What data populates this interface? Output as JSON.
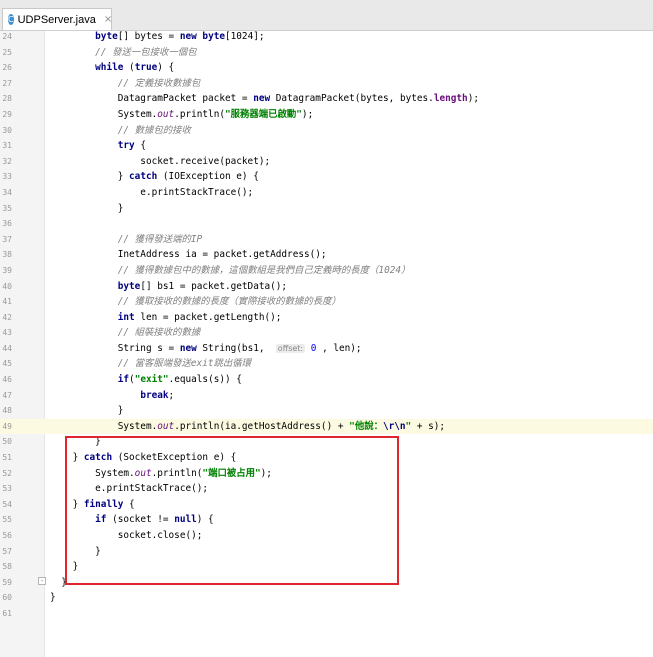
{
  "tab": {
    "icon": "C",
    "label": "UDPServer.java",
    "close": "×"
  },
  "lines": [
    {
      "n": "24",
      "segs": [
        [
          "p",
          "        "
        ],
        [
          "kw",
          "byte"
        ],
        [
          "p",
          "[] bytes = "
        ],
        [
          "kw",
          "new"
        ],
        [
          "p",
          " "
        ],
        [
          "kw",
          "byte"
        ],
        [
          "p",
          "[1024];"
        ]
      ]
    },
    {
      "n": "25",
      "segs": [
        [
          "p",
          "        "
        ],
        [
          "cm",
          "// 發送一包接收一個包"
        ]
      ]
    },
    {
      "n": "26",
      "segs": [
        [
          "p",
          "        "
        ],
        [
          "kw",
          "while"
        ],
        [
          "p",
          " ("
        ],
        [
          "kw",
          "true"
        ],
        [
          "p",
          ") {"
        ]
      ]
    },
    {
      "n": "27",
      "segs": [
        [
          "p",
          "            "
        ],
        [
          "cm",
          "// 定義接收數據包"
        ]
      ]
    },
    {
      "n": "28",
      "segs": [
        [
          "p",
          "            DatagramPacket packet = "
        ],
        [
          "kw",
          "new"
        ],
        [
          "p",
          " DatagramPacket(bytes, bytes."
        ],
        [
          "fld",
          "length"
        ],
        [
          "p",
          ");"
        ]
      ]
    },
    {
      "n": "29",
      "segs": [
        [
          "p",
          "            System."
        ],
        [
          "st",
          "out"
        ],
        [
          "p",
          ".println("
        ],
        [
          "str",
          "\"服務器端已啟動\""
        ],
        [
          "p",
          ");"
        ]
      ]
    },
    {
      "n": "30",
      "segs": [
        [
          "p",
          "            "
        ],
        [
          "cm",
          "// 數據包的接收"
        ]
      ]
    },
    {
      "n": "31",
      "segs": [
        [
          "p",
          "            "
        ],
        [
          "kw",
          "try"
        ],
        [
          "p",
          " {"
        ]
      ]
    },
    {
      "n": "32",
      "segs": [
        [
          "p",
          "                socket.receive(packet);"
        ]
      ]
    },
    {
      "n": "33",
      "segs": [
        [
          "p",
          "            } "
        ],
        [
          "kw",
          "catch"
        ],
        [
          "p",
          " (IOException e) {"
        ]
      ]
    },
    {
      "n": "34",
      "segs": [
        [
          "p",
          "                e.printStackTrace();"
        ]
      ]
    },
    {
      "n": "35",
      "segs": [
        [
          "p",
          "            }"
        ]
      ]
    },
    {
      "n": "36",
      "segs": []
    },
    {
      "n": "37",
      "segs": [
        [
          "p",
          "            "
        ],
        [
          "cm",
          "// 獲得發送端的IP"
        ]
      ]
    },
    {
      "n": "38",
      "segs": [
        [
          "p",
          "            InetAddress ia = packet.getAddress();"
        ]
      ]
    },
    {
      "n": "39",
      "segs": [
        [
          "p",
          "            "
        ],
        [
          "cm",
          "// 獲得數據包中的數據，這個數組是我們自己定義時的長度（1024）"
        ]
      ]
    },
    {
      "n": "40",
      "segs": [
        [
          "p",
          "            "
        ],
        [
          "kw",
          "byte"
        ],
        [
          "p",
          "[] bs1 = packet.getData();"
        ]
      ]
    },
    {
      "n": "41",
      "segs": [
        [
          "p",
          "            "
        ],
        [
          "cm",
          "// 獲取接收的數據的長度（實際接收的數據的長度）"
        ]
      ]
    },
    {
      "n": "42",
      "segs": [
        [
          "p",
          "            "
        ],
        [
          "kw",
          "int"
        ],
        [
          "p",
          " len = packet.getLength();"
        ]
      ]
    },
    {
      "n": "43",
      "segs": [
        [
          "p",
          "            "
        ],
        [
          "cm",
          "// 組裝接收的數據"
        ]
      ]
    },
    {
      "n": "44",
      "segs": [
        [
          "p",
          "            String s = "
        ],
        [
          "kw",
          "new"
        ],
        [
          "p",
          " String(bs1,  "
        ],
        [
          "hint",
          "offset:"
        ],
        [
          "hintv",
          " 0"
        ],
        [
          "p",
          " , len);"
        ]
      ]
    },
    {
      "n": "45",
      "segs": [
        [
          "p",
          "            "
        ],
        [
          "cm",
          "// 當客服端發送exit跳出循環"
        ]
      ]
    },
    {
      "n": "46",
      "segs": [
        [
          "p",
          "            "
        ],
        [
          "kw",
          "if"
        ],
        [
          "p",
          "("
        ],
        [
          "str",
          "\"exit\""
        ],
        [
          "p",
          ".equals(s)) {"
        ]
      ]
    },
    {
      "n": "47",
      "segs": [
        [
          "p",
          "                "
        ],
        [
          "kw",
          "break"
        ],
        [
          "p",
          ";"
        ]
      ]
    },
    {
      "n": "48",
      "segs": [
        [
          "p",
          "            }"
        ]
      ]
    },
    {
      "n": "49",
      "current": true,
      "segs": [
        [
          "p",
          "            System."
        ],
        [
          "st",
          "out"
        ],
        [
          "p",
          ".println(ia.getHostAddress() + "
        ],
        [
          "str",
          "\"他說："
        ],
        [
          "esc",
          "\\r\\n"
        ],
        [
          "str",
          "\""
        ],
        [
          "p",
          " + s);"
        ]
      ]
    },
    {
      "n": "50",
      "segs": [
        [
          "p",
          "        }"
        ]
      ]
    },
    {
      "n": "51",
      "segs": [
        [
          "p",
          "    } "
        ],
        [
          "kw",
          "catch"
        ],
        [
          "p",
          " (SocketException e) {"
        ]
      ]
    },
    {
      "n": "52",
      "segs": [
        [
          "p",
          "        System."
        ],
        [
          "st",
          "out"
        ],
        [
          "p",
          ".println("
        ],
        [
          "str",
          "\"端口被占用\""
        ],
        [
          "p",
          ");"
        ]
      ]
    },
    {
      "n": "53",
      "segs": [
        [
          "p",
          "        e.printStackTrace();"
        ]
      ]
    },
    {
      "n": "54",
      "segs": [
        [
          "p",
          "    } "
        ],
        [
          "kw",
          "finally"
        ],
        [
          "p",
          " {"
        ]
      ]
    },
    {
      "n": "55",
      "segs": [
        [
          "p",
          "        "
        ],
        [
          "kw",
          "if"
        ],
        [
          "p",
          " (socket != "
        ],
        [
          "kw",
          "null"
        ],
        [
          "p",
          ") {"
        ]
      ]
    },
    {
      "n": "56",
      "segs": [
        [
          "p",
          "            socket.close();"
        ]
      ]
    },
    {
      "n": "57",
      "segs": [
        [
          "p",
          "        }"
        ]
      ]
    },
    {
      "n": "58",
      "segs": [
        [
          "p",
          "    }"
        ]
      ]
    },
    {
      "n": "59",
      "segs": [
        [
          "p",
          "  }"
        ]
      ]
    },
    {
      "n": "60",
      "segs": [
        [
          "p",
          "}"
        ]
      ]
    },
    {
      "n": "61",
      "segs": []
    }
  ]
}
